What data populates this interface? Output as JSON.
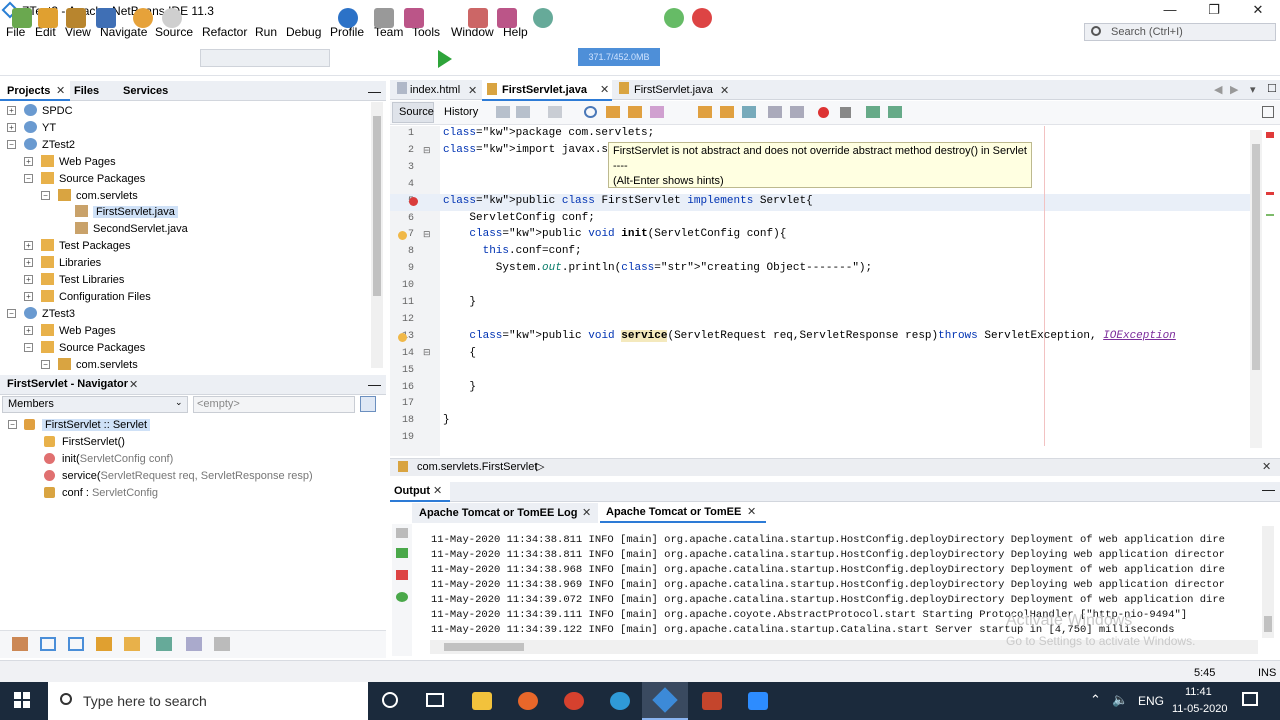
{
  "window": {
    "title": "ZTest3 - Apache NetBeans IDE 11.3",
    "min": "—",
    "max": "❐",
    "close": "✕"
  },
  "menu": [
    "File",
    "Edit",
    "View",
    "Navigate",
    "Source",
    "Refactor",
    "Run",
    "Debug",
    "Profile",
    "Team",
    "Tools",
    "Window",
    "Help"
  ],
  "search_placeholder": "Search (Ctrl+I)",
  "memory": "371.7/452.0MB",
  "projects": {
    "tabs": [
      "Projects",
      "Files",
      "Services"
    ],
    "tree": [
      {
        "label": "SPDC",
        "level": 0,
        "toggle": "+",
        "icon": "project"
      },
      {
        "label": "YT",
        "level": 0,
        "toggle": "+",
        "icon": "project"
      },
      {
        "label": "ZTest2",
        "level": 0,
        "toggle": "−",
        "icon": "project"
      },
      {
        "label": "Web Pages",
        "level": 1,
        "toggle": "+",
        "icon": "folder"
      },
      {
        "label": "Source Packages",
        "level": 1,
        "toggle": "−",
        "icon": "folder"
      },
      {
        "label": "com.servlets",
        "level": 2,
        "toggle": "−",
        "icon": "package"
      },
      {
        "label": "FirstServlet.java",
        "level": 3,
        "toggle": "",
        "icon": "java",
        "selected": true
      },
      {
        "label": "SecondServlet.java",
        "level": 3,
        "toggle": "",
        "icon": "java"
      },
      {
        "label": "Test Packages",
        "level": 1,
        "toggle": "+",
        "icon": "folder"
      },
      {
        "label": "Libraries",
        "level": 1,
        "toggle": "+",
        "icon": "folder"
      },
      {
        "label": "Test Libraries",
        "level": 1,
        "toggle": "+",
        "icon": "folder"
      },
      {
        "label": "Configuration Files",
        "level": 1,
        "toggle": "+",
        "icon": "folder"
      },
      {
        "label": "ZTest3",
        "level": 0,
        "toggle": "−",
        "icon": "project"
      },
      {
        "label": "Web Pages",
        "level": 1,
        "toggle": "+",
        "icon": "folder"
      },
      {
        "label": "Source Packages",
        "level": 1,
        "toggle": "−",
        "icon": "folder"
      },
      {
        "label": "com.servlets",
        "level": 2,
        "toggle": "−",
        "icon": "package"
      }
    ]
  },
  "navigator": {
    "title": "FirstServlet - Navigator",
    "members": "Members",
    "filter": "<empty>",
    "items": [
      {
        "label": "FirstServlet :: Servlet",
        "extra": "",
        "icon": "class"
      },
      {
        "label": "FirstServlet()",
        "extra": "",
        "icon": "ctor"
      },
      {
        "label": "init(",
        "extra": "ServletConfig conf)",
        "icon": "method"
      },
      {
        "label": "service(",
        "extra": "ServletRequest req, ServletResponse resp)",
        "icon": "method"
      },
      {
        "label": "conf : ",
        "extra": "ServletConfig",
        "icon": "field"
      }
    ]
  },
  "editor": {
    "tabs": [
      "index.html",
      "FirstServlet.java",
      "FirstServlet.java"
    ],
    "active_tab": 1,
    "source": "Source",
    "history": "History",
    "tooltip": [
      "FirstServlet is not abstract and does not override abstract method destroy() in Servlet",
      "----",
      "(Alt-Enter shows hints)"
    ],
    "breadcrumb": "com.servlets.FirstServlet",
    "lines": [
      {
        "n": "1",
        "t": "package com.servlets;"
      },
      {
        "n": "2",
        "t": "import javax.servlet.*"
      },
      {
        "n": "3",
        "t": ""
      },
      {
        "n": "4",
        "t": ""
      },
      {
        "n": "5",
        "t": "public class FirstServlet implements Servlet{"
      },
      {
        "n": "6",
        "t": "    ServletConfig conf;"
      },
      {
        "n": "7",
        "t": "    public void init(ServletConfig conf){"
      },
      {
        "n": "8",
        "t": "      this.conf=conf;"
      },
      {
        "n": "9",
        "t": "        System.out.println(\"creating Object-------\");"
      },
      {
        "n": "10",
        "t": ""
      },
      {
        "n": "11",
        "t": "    }"
      },
      {
        "n": "12",
        "t": ""
      },
      {
        "n": "13",
        "t": "    public void service(ServletRequest req,ServletResponse resp)throws ServletException, IOException"
      },
      {
        "n": "14",
        "t": "    {"
      },
      {
        "n": "15",
        "t": ""
      },
      {
        "n": "16",
        "t": "    }"
      },
      {
        "n": "17",
        "t": ""
      },
      {
        "n": "18",
        "t": "}"
      },
      {
        "n": "19",
        "t": ""
      }
    ]
  },
  "output": {
    "title": "Output",
    "tabs": [
      "Apache Tomcat or TomEE Log",
      "Apache Tomcat or TomEE"
    ],
    "lines": [
      "11-May-2020 11:34:38.811 INFO [main] org.apache.catalina.startup.HostConfig.deployDirectory Deployment of web application dire",
      "11-May-2020 11:34:38.811 INFO [main] org.apache.catalina.startup.HostConfig.deployDirectory Deploying web application director",
      "11-May-2020 11:34:38.968 INFO [main] org.apache.catalina.startup.HostConfig.deployDirectory Deployment of web application dire",
      "11-May-2020 11:34:38.969 INFO [main] org.apache.catalina.startup.HostConfig.deployDirectory Deploying web application director",
      "11-May-2020 11:34:39.072 INFO [main] org.apache.catalina.startup.HostConfig.deployDirectory Deployment of web application dire",
      "11-May-2020 11:34:39.111 INFO [main] org.apache.coyote.AbstractProtocol.start Starting ProtocolHandler [\"http-nio-9494\"]",
      "11-May-2020 11:34:39.122 INFO [main] org.apache.catalina.startup.Catalina.start Server startup in [4,750] milliseconds"
    ]
  },
  "watermark": {
    "line1": "Activate Windows",
    "line2": "Go to Settings to activate Windows."
  },
  "status": {
    "pos": "5:45",
    "mode": "INS"
  },
  "taskbar": {
    "search": "Type here to search",
    "lang": "ENG",
    "time": "11:41",
    "date": "11-05-2020"
  },
  "colors": {
    "accent": "#2d7bd6",
    "selection": "#cfe1f7",
    "taskbar": "#1b2a3c"
  }
}
